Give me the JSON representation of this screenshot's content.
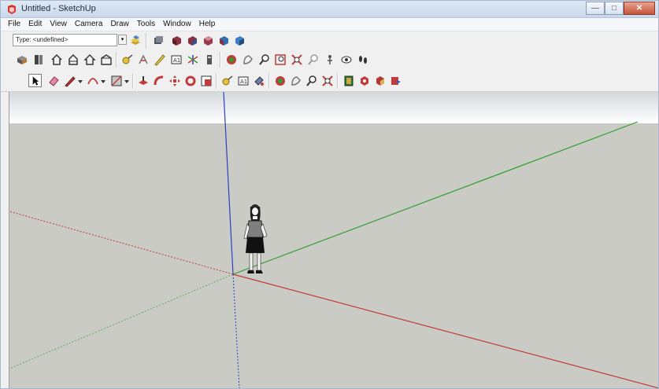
{
  "window": {
    "title": "Untitled - SketchUp",
    "min_label": "—",
    "max_label": "□",
    "close_label": "✕"
  },
  "menu": [
    {
      "label": "File"
    },
    {
      "label": "Edit"
    },
    {
      "label": "View"
    },
    {
      "label": "Camera"
    },
    {
      "label": "Draw"
    },
    {
      "label": "Tools"
    },
    {
      "label": "Window"
    },
    {
      "label": "Help"
    }
  ],
  "toolbar": {
    "type_value": "Type: <undefined>",
    "row1_icons": [
      "layers-icon",
      "paint-bucket-icon",
      "cube-icon",
      "cube-icon",
      "cube-icon",
      "cube-icon"
    ],
    "row2_icons": [
      "components-icon",
      "materials-icon",
      "home-icon",
      "house-icon",
      "house-outline-icon",
      "house-front-icon",
      "tape-icon",
      "protractor-icon",
      "dimension-icon",
      "text-icon",
      "axes-icon",
      "3d-text-icon",
      "orbit-icon",
      "pan-icon",
      "zoom-icon",
      "zoom-window-icon",
      "zoom-extents-icon",
      "previous-icon",
      "position-camera-icon",
      "look-around-icon",
      "walk-icon"
    ],
    "row3_icons": [
      "select-icon",
      "eraser-icon",
      "pencil-icon",
      "arc-icon",
      "rectangle-icon",
      "push-pull-icon",
      "follow-me-icon",
      "move-icon",
      "rotate-icon",
      "scale-icon",
      "tape-measure-icon",
      "text-tool-icon",
      "paint-icon",
      "orbit-icon",
      "pan-icon",
      "zoom-icon",
      "zoom-extents-icon",
      "warehouse-icon",
      "share-icon",
      "extensions-icon",
      "send-icon"
    ]
  },
  "colors": {
    "sky": "#ffffff",
    "ground": "#cbcbc6",
    "axis_red": "#c23a3a",
    "axis_green": "#2f9f2f",
    "axis_blue": "#2e3fbe"
  }
}
